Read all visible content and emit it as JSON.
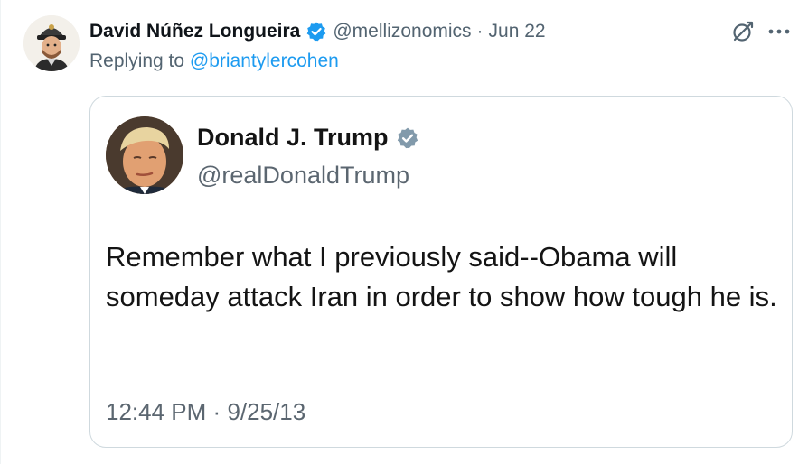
{
  "tweet": {
    "author_name": "David Núñez Longueira",
    "handle": "@mellizonomics",
    "separator": "·",
    "date": "Jun 22",
    "replying_prefix": "Replying to ",
    "replying_to": "@briantylercohen",
    "verified_color": "#1d9bf0",
    "icons": [
      "verified-badge-icon",
      "grok-icon",
      "more-options-icon"
    ]
  },
  "quote": {
    "author_name": "Donald J. Trump",
    "handle": "@realDonaldTrump",
    "text": "Remember what I previously said--Obama will someday attack Iran in order to show how tough he is.",
    "time": "12:44 PM",
    "separator": "·",
    "date": "9/25/13",
    "verified_color": "#829aab"
  }
}
